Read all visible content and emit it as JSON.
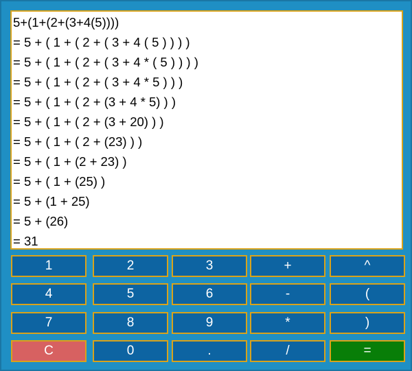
{
  "display": {
    "lines": [
      "5+(1+(2+(3+4(5))))",
      "= 5 + ( 1 + ( 2 + ( 3 + 4 ( 5 ) ) ) )",
      "= 5 + ( 1 + ( 2 + ( 3 + 4 * ( 5 ) ) ) )",
      "= 5 + ( 1 + ( 2 + ( 3 + 4 * 5 ) ) )",
      "= 5 + ( 1 + ( 2 + (3 + 4 * 5) ) )",
      "= 5 + ( 1 + ( 2 + (3 + 20) ) )",
      "= 5 + ( 1 + ( 2 + (23) ) )",
      "= 5 + ( 1 + (2 + 23) )",
      "= 5 + ( 1 + (25) )",
      "= 5 + (1 + 25)",
      "= 5 + (26)",
      "= 31"
    ]
  },
  "keypad": {
    "keys": [
      [
        "1",
        "2",
        "3",
        "+",
        "^"
      ],
      [
        "4",
        "5",
        "6",
        "-",
        "("
      ],
      [
        "7",
        "8",
        "9",
        "*",
        ")"
      ],
      [
        "C",
        "0",
        ".",
        "/",
        "="
      ]
    ]
  },
  "colors": {
    "background": "#1f8fc4",
    "key": "#0d64a2",
    "key_border": "#d9a21a",
    "clear_key": "#d76161",
    "equals_key": "#087e08",
    "display_background": "#ffffff"
  }
}
